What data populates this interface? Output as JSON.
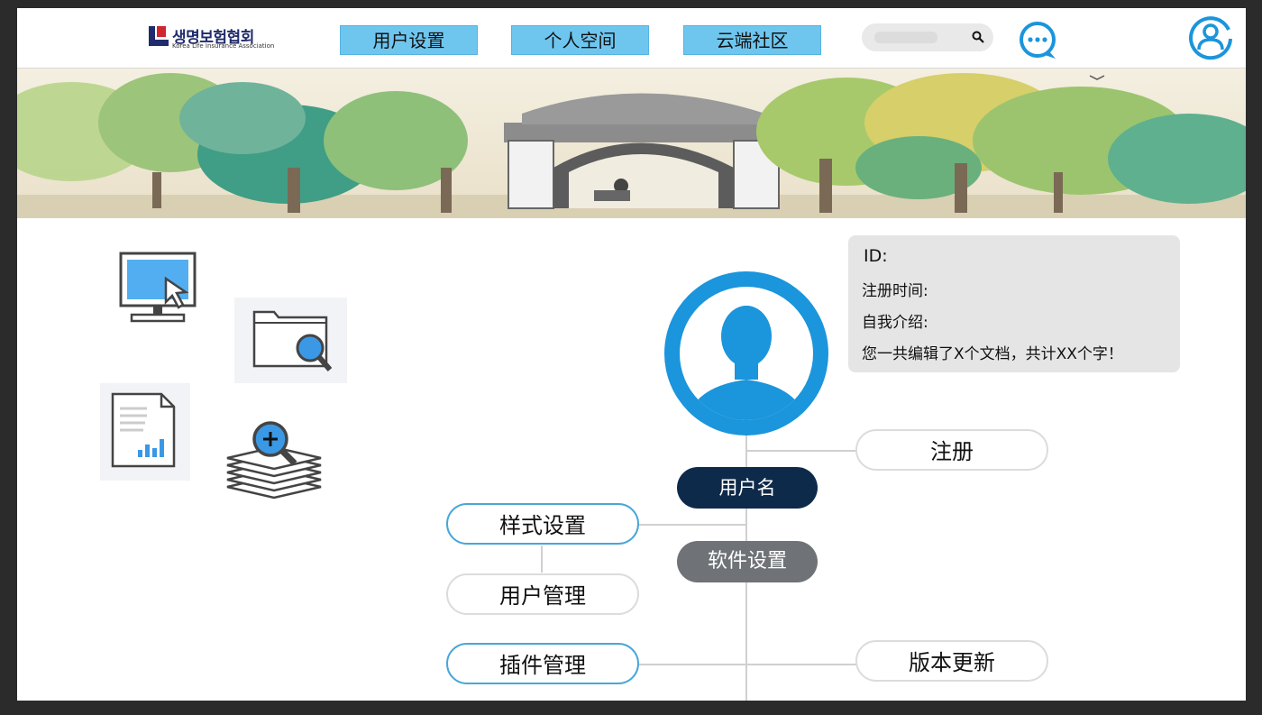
{
  "header": {
    "logo_text": "생명보험협회",
    "logo_sub": "Korea Life Insurance Association",
    "nav": [
      "用户设置",
      "个人空间",
      "云端社区"
    ]
  },
  "profile": {
    "info": {
      "id_label": "ID:",
      "register_time_label": "注册时间:",
      "intro_label": "自我介绍:",
      "stats": "您一共编辑了X个文档，共计XX个字！"
    }
  },
  "tree": {
    "username": "用户名",
    "register": "注册",
    "software_settings": "软件设置",
    "style_settings": "样式设置",
    "user_management": "用户管理",
    "plugin_management": "插件管理",
    "version_update": "版本更新"
  },
  "colors": {
    "accent": "#1b95db",
    "nav_bg": "#6ec6ef",
    "dark_pill": "#0e2a4a",
    "gray_pill": "#6f7276"
  },
  "icons": [
    "monitor-cursor-icon",
    "folder-search-icon",
    "document-chart-icon",
    "stack-search-icon",
    "search-icon",
    "chat-icon",
    "user-profile-icon",
    "avatar-icon"
  ]
}
